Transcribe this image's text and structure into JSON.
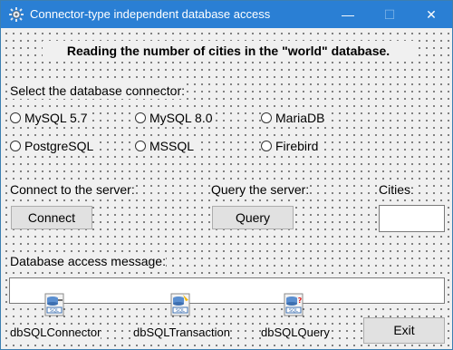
{
  "window": {
    "title": "Connector-type independent database access",
    "controls": {
      "minimize": "—",
      "maximize": "☐",
      "close": "✕"
    }
  },
  "form": {
    "heading": "Reading the number of cities in the \"world\" database.",
    "connector_label": "Select the database connector:",
    "connectors": [
      "MySQL 5.7",
      "MySQL 8.0",
      "MariaDB",
      "PostgreSQL",
      "MSSQL",
      "Firebird"
    ],
    "connect_label": "Connect to the server:",
    "connect_button": "Connect",
    "query_label": "Query the server:",
    "query_button": "Query",
    "cities_label": "Cities:",
    "cities_value": "",
    "message_label": "Database access message:",
    "message_value": "",
    "exit_button": "Exit"
  },
  "components": [
    {
      "name": "dbSQLConnector",
      "icon": "sql-connector-icon"
    },
    {
      "name": "dbSQLTransaction",
      "icon": "sql-transaction-icon"
    },
    {
      "name": "dbSQLQuery",
      "icon": "sql-query-icon"
    }
  ],
  "colors": {
    "titlebar": "#2a7fd4",
    "form_bg": "#f0f0f0",
    "button_bg": "#e1e1e1"
  }
}
